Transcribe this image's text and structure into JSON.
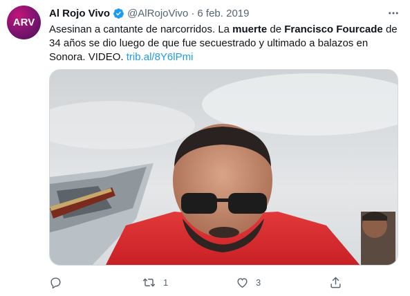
{
  "tweet": {
    "author_name": "Al Rojo Vivo",
    "author_handle": "@AlRojoVivo",
    "separator": "·",
    "date": "6 feb. 2019",
    "avatar_logo_text": "ARV",
    "text_segments": [
      {
        "text": "Asesinan a cantante de narcorridos. La ",
        "style": "normal"
      },
      {
        "text": "muerte",
        "style": "bold"
      },
      {
        "text": " de ",
        "style": "normal"
      },
      {
        "text": "Francisco Fourcade",
        "style": "bold"
      },
      {
        "text": " de 34 años se dio luego de que fue secuestrado y ultimado a balazos en Sonora. VIDEO. ",
        "style": "normal"
      },
      {
        "text": "trib.al/8Y6lPmi",
        "style": "link"
      }
    ]
  },
  "actions": {
    "reply_count": "",
    "retweet_count": "1",
    "like_count": "3"
  },
  "icons": {
    "verified": "verified-badge-icon",
    "more": "more-options-icon",
    "reply": "reply-icon",
    "retweet": "retweet-icon",
    "like": "heart-icon",
    "share": "share-icon"
  },
  "colors": {
    "text": "#0f1419",
    "secondary": "#536471",
    "link": "#1d9bf0",
    "verified": "#1d9bf0",
    "avatar": "#7b1470"
  }
}
